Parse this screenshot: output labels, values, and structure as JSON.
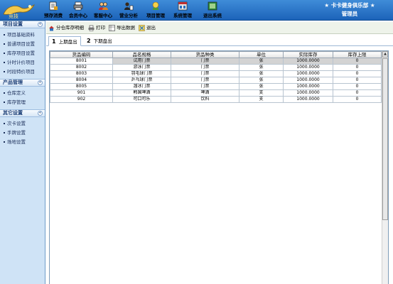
{
  "app": {
    "logo_text": "竞技",
    "user_club": "卡卡健身俱乐部",
    "user_role": "管理员",
    "star": "★"
  },
  "toolbar": [
    {
      "label": "预存消费",
      "icon": "receipt-icon"
    },
    {
      "label": "会员中心",
      "icon": "printer-icon"
    },
    {
      "label": "客服中心",
      "icon": "people-icon"
    },
    {
      "label": "营业分析",
      "icon": "chart-person-icon"
    },
    {
      "label": "项目管理",
      "icon": "project-icon"
    },
    {
      "label": "系统管理",
      "icon": "settings-window-icon"
    },
    {
      "label": "退出系统",
      "icon": "exit-window-icon"
    }
  ],
  "sidebar": {
    "sections": [
      {
        "title": "项目设置",
        "collapse": "«",
        "items": [
          "项目基础资料",
          "普通项目设置",
          "库存项目设置",
          "计时计价项目",
          "时段特价项目"
        ]
      },
      {
        "title": "产品管理",
        "collapse": "«",
        "items": [
          "仓库定义",
          "库存管理"
        ]
      },
      {
        "title": "其它设置",
        "collapse": "«",
        "items": [
          "次卡设置",
          "手牌设置",
          "场地设置"
        ]
      }
    ]
  },
  "actions": {
    "title": "分仓库存明细",
    "print": "打印",
    "export": "导出数据",
    "exit": "退出"
  },
  "tabs": [
    {
      "num": "1",
      "label": "上期盘出"
    },
    {
      "num": "2",
      "label": "下期盘出"
    }
  ],
  "table": {
    "headers": [
      "货品编码",
      "品名规格",
      "货品种类",
      "单位",
      "实际库存",
      "库存上限"
    ],
    "rows": [
      [
        "8001",
        "试用门票",
        "门票",
        "张",
        "1000.0000",
        "0"
      ],
      [
        "8002",
        "游泳门票",
        "门票",
        "张",
        "1000.0000",
        "0"
      ],
      [
        "8003",
        "羽毛球门票",
        "门票",
        "张",
        "1000.0000",
        "0"
      ],
      [
        "8004",
        "乒乓球门票",
        "门票",
        "张",
        "1000.0000",
        "0"
      ],
      [
        "8005",
        "溜冰门票",
        "门票",
        "张",
        "1000.0000",
        "0"
      ],
      [
        "901",
        "韩国啤酒",
        "啤酒",
        "支",
        "1000.0000",
        "0"
      ],
      [
        "902",
        "可口可乐",
        "饮料",
        "支",
        "1000.0000",
        "0"
      ]
    ],
    "selected_row": 0
  },
  "colors": {
    "topbar": "#2a74c9",
    "sidebar": "#cfe3f6",
    "selected_row": "#d3d3d3"
  }
}
